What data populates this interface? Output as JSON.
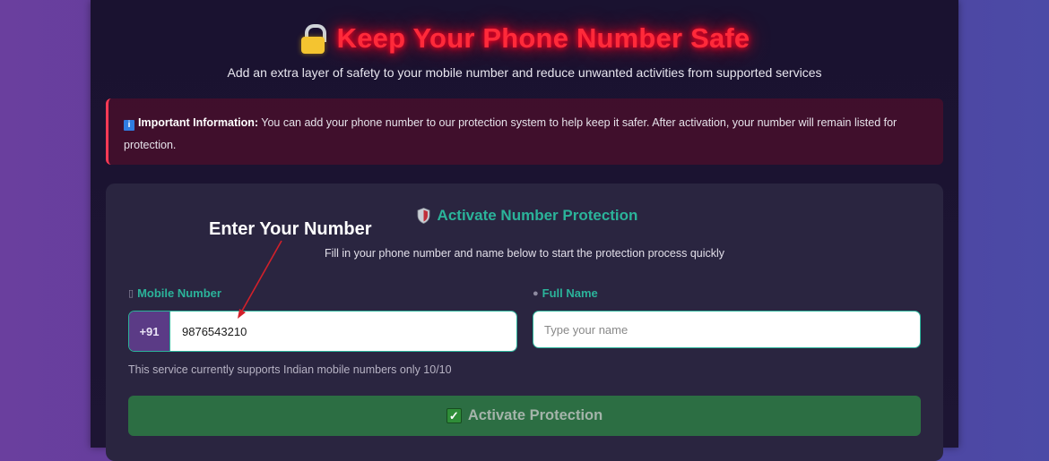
{
  "header": {
    "title": "Keep Your Phone Number Safe",
    "subtitle": "Add an extra layer of safety to your mobile number and reduce unwanted activities from supported services",
    "title_icon": "lock-icon"
  },
  "info": {
    "icon": "info-icon",
    "label": "Important Information:",
    "text": " You can add your phone number to our protection system to help keep it safer. After activation, your number will remain listed for protection."
  },
  "form": {
    "title": "Activate Number Protection",
    "title_icon": "shield-icon",
    "description": "Fill in your phone number and name below to start the protection process quickly",
    "mobile_label": "Mobile Number",
    "mobile_label_icon": "phone-icon",
    "country_code": "+91",
    "mobile_value": "9876543210",
    "name_label": "Full Name",
    "name_label_icon": "user-icon",
    "name_placeholder": "Type your name",
    "name_value": "",
    "help_text": "This service currently supports Indian mobile numbers only 10/10",
    "submit_label": "Activate Protection",
    "submit_icon": "check-icon"
  },
  "annotation": {
    "label": "Enter Your Number",
    "color": "#d3202a"
  },
  "colors": {
    "title_red": "#ff2a3a",
    "accent_teal": "#2bb39a",
    "button_green": "#2c6e43",
    "code_purple": "#5b3b86"
  }
}
